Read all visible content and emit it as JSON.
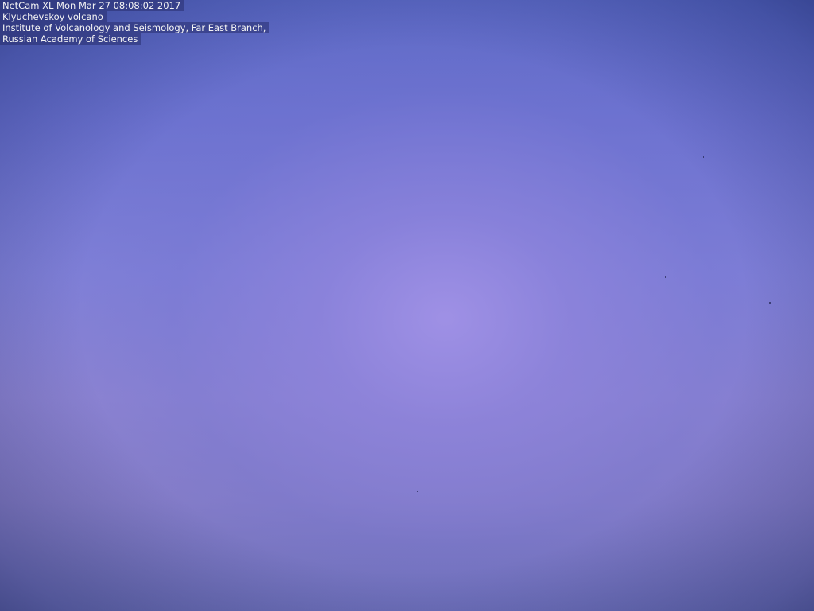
{
  "webcam_image": {
    "overlay": {
      "camera_timestamp": "NetCam XL Mon Mar 27 08:08:02 2017",
      "location": "Klyuchevskoy volcano",
      "institute_line1": "Institute of Volcanology and Seismology, Far East Branch,",
      "institute_line2": "Russian Academy of Sciences"
    },
    "colors": {
      "sky_center": "#9a8fdc",
      "sky_edge": "#4a5cb0",
      "overlay_text": "#f4f4f4"
    }
  }
}
